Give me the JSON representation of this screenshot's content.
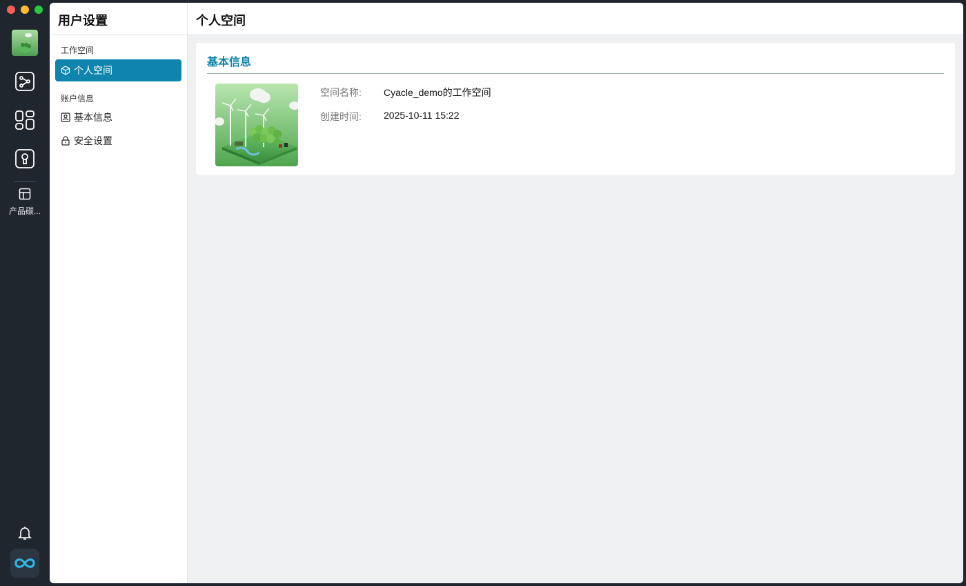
{
  "rail": {
    "items": [
      {
        "icon": "workflow-icon"
      },
      {
        "icon": "apps-grid-icon"
      },
      {
        "icon": "keyhole-icon"
      }
    ],
    "product_label": "产品碳...",
    "bell_icon": "bell-icon",
    "logo_icon": "infinity-logo-icon"
  },
  "sidebar": {
    "title": "用户设置",
    "sections": [
      {
        "label": "工作空间",
        "items": [
          {
            "label": "个人空间",
            "icon": "cube-icon",
            "active": true
          }
        ]
      },
      {
        "label": "账户信息",
        "items": [
          {
            "label": "基本信息",
            "icon": "user-card-icon",
            "active": false
          },
          {
            "label": "安全设置",
            "icon": "lock-icon",
            "active": false
          }
        ]
      }
    ]
  },
  "main": {
    "title": "个人空间",
    "card": {
      "title": "基本信息",
      "fields": [
        {
          "key": "空间名称:",
          "value": "Cyacle_demo的工作空间"
        },
        {
          "key": "创建时间:",
          "value": "2025-10-11 15:22"
        }
      ]
    }
  },
  "colors": {
    "accent": "#0f84ad",
    "rail_bg": "#1f262e",
    "panel_bg": "#eff0f2"
  }
}
